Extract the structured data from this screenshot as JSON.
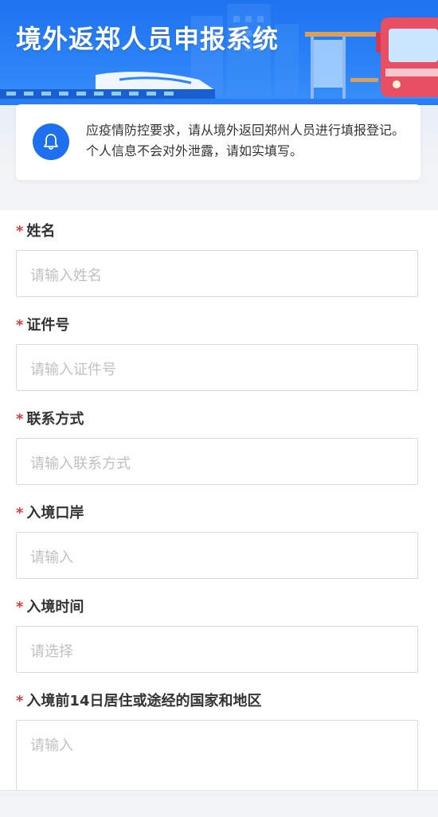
{
  "header": {
    "title": "境外返郑人员申报系统"
  },
  "notice": {
    "icon": "bell-icon",
    "text": "应疫情防控要求，请从境外返回郑州人员进行填报登记。个人信息不会对外泄露，请如实填写。"
  },
  "colors": {
    "brand": "#1f72f0",
    "required": "#e23a3a",
    "placeholder": "#c0c0c0"
  },
  "form": {
    "fields": [
      {
        "label": "姓名",
        "placeholder": "请输入姓名"
      },
      {
        "label": "证件号",
        "placeholder": "请输入证件号"
      },
      {
        "label": "联系方式",
        "placeholder": "请输入联系方式"
      },
      {
        "label": "入境口岸",
        "placeholder": "请输入"
      },
      {
        "label": "入境时间",
        "placeholder": "请选择"
      },
      {
        "label": "入境前14日居住或途经的国家和地区",
        "placeholder": "请输入"
      }
    ],
    "required_mark": "*"
  }
}
